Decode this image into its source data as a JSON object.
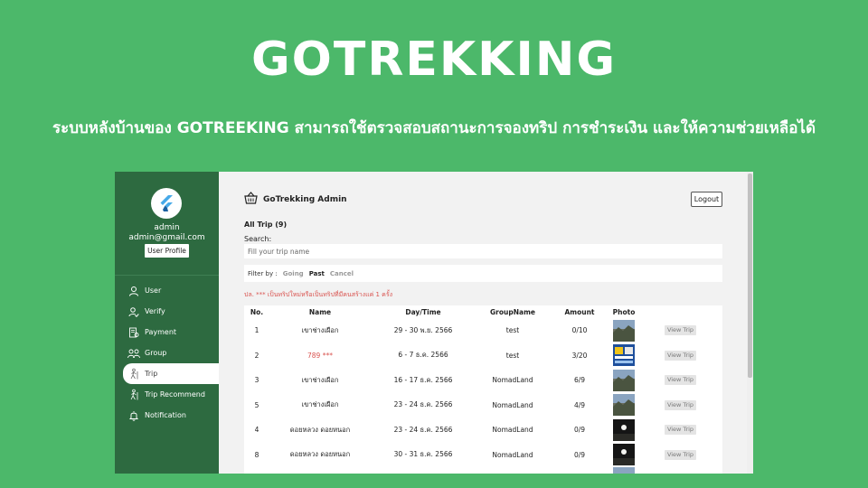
{
  "hero": {
    "title": "GOTREKKING",
    "subtitle": "ระบบหลังบ้านของ GOTREEKING สามารถใช้ตรวจสอบสถานะการจองทริป การชำระเงิน และให้ความช่วยเหลือได้"
  },
  "sidebar": {
    "admin_name": "admin",
    "admin_email": "admin@gmail.com",
    "profile_button": "User Profile",
    "items": [
      {
        "label": "User",
        "icon": "user-icon"
      },
      {
        "label": "Verify",
        "icon": "verify-icon"
      },
      {
        "label": "Payment",
        "icon": "payment-icon"
      },
      {
        "label": "Group",
        "icon": "group-icon"
      },
      {
        "label": "Trip",
        "icon": "trip-icon",
        "active": true
      },
      {
        "label": "Trip Recommend",
        "icon": "trip-recommend-icon"
      },
      {
        "label": "Notification",
        "icon": "bell-icon"
      }
    ]
  },
  "header": {
    "brand": "GoTrekking Admin",
    "logout": "Logout"
  },
  "content": {
    "all_trip": "All Trip (9)",
    "search_label": "Search:",
    "search_placeholder": "Fill your trip name",
    "filter_label": "Filter by :",
    "filters": [
      "Going",
      "Past",
      "Cancel"
    ],
    "active_filter": "Past",
    "note": "ปล. *** เป็นทริปใหม่หรือเป็นทริปที่มีคนสร้างแค่ 1 ครั้ง"
  },
  "table": {
    "headers": [
      "No.",
      "Name",
      "Day/Time",
      "GroupName",
      "Amount",
      "Photo",
      ""
    ],
    "view_label": "View Trip",
    "rows": [
      {
        "no": "1",
        "name": "เขาช่างเผือก",
        "day": "29 - 30 พ.ย. 2566",
        "group": "test",
        "amount": "0/10",
        "photo": "mountain"
      },
      {
        "no": "2",
        "name": "789 ***",
        "day": "6 - 7 ธ.ค. 2566",
        "group": "test",
        "amount": "3/20",
        "photo": "poster"
      },
      {
        "no": "3",
        "name": "เขาช่างเผือก",
        "day": "16 - 17 ธ.ค. 2566",
        "group": "NomadLand",
        "amount": "6/9",
        "photo": "mountain"
      },
      {
        "no": "5",
        "name": "เขาช่างเผือก",
        "day": "23 - 24 ธ.ค. 2566",
        "group": "NomadLand",
        "amount": "4/9",
        "photo": "mountain"
      },
      {
        "no": "4",
        "name": "ดอยหลวง ดอยหนอก",
        "day": "23 - 24 ธ.ค. 2566",
        "group": "NomadLand",
        "amount": "0/9",
        "photo": "night"
      },
      {
        "no": "8",
        "name": "ดอยหลวง ดอยหนอก",
        "day": "30 - 31 ธ.ค. 2566",
        "group": "NomadLand",
        "amount": "0/9",
        "photo": "night"
      }
    ]
  },
  "colors": {
    "background": "#4cb86a",
    "sidebar": "#2d6a40",
    "note_red": "#d9534f"
  }
}
